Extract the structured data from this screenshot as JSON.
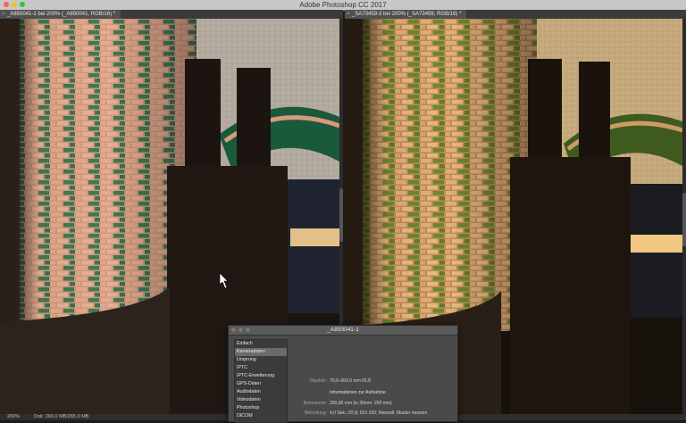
{
  "app": {
    "title": "Adobe Photoshop CC 2017"
  },
  "documents": {
    "left": {
      "tab_label": "_A850041-1 bei 200% (_A850041, RGB/16) *"
    },
    "right": {
      "tab_label": "_SA73459-3 bei 200% (_SA73459, RGB/16) *"
    }
  },
  "status_bar": {
    "zoom": "200%",
    "doc_info": "Dok: 260,0 MB/265,0 MB"
  },
  "dialog": {
    "title": "_A850041-1",
    "categories": [
      "Einfach",
      "Kameradaten",
      "Ursprung",
      "IPTC",
      "IPTC-Erweiterung",
      "GPS-Daten",
      "Audiodaten",
      "Videodaten",
      "Photoshop",
      "DICOM"
    ],
    "selected_category": "Kameradaten",
    "fields": {
      "lens_label": "Objektiv:",
      "lens_value": "70,0–200,0 mm f/2,8",
      "section_title": "Informationen zur Aufnahme",
      "focal_label": "Brennweite:",
      "focal_value": "200,00 mm   (in 35mm: 200 mm)",
      "exposure_label": "Belichtung:",
      "exposure_value": "4,0 Sek.;  f/2,8;  ISO 100;   Manuell;   Muster messen"
    }
  },
  "colors": {
    "traffic_red": "#ff5f57",
    "traffic_yellow": "#febc2e",
    "traffic_green": "#28c840"
  }
}
